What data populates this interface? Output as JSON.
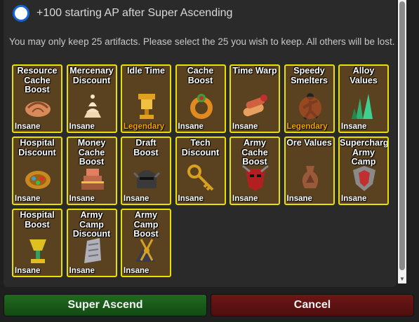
{
  "option": {
    "label": "+100 starting AP after Super Ascending",
    "selected": false
  },
  "info_text": "You may only keep 25 artifacts.  Please select the 25 you wish to keep.  All others will be lost.",
  "colors": {
    "insane": "#ffffff",
    "legendary": "#f0a800",
    "card_border": "#e8e000",
    "card_bg": "#5a4220"
  },
  "artifacts": [
    {
      "title": "Resource Cache Boost",
      "rarity": "Insane",
      "icon": "croissant-icon"
    },
    {
      "title": "Mercenary Discount",
      "rarity": "Insane",
      "icon": "cream-swirl-icon"
    },
    {
      "title": "Idle Time",
      "rarity": "Legendary",
      "icon": "golden-chalice-icon"
    },
    {
      "title": "Cache Boost",
      "rarity": "Insane",
      "icon": "jeweled-ring-icon"
    },
    {
      "title": "Time Warp",
      "rarity": "Insane",
      "icon": "scroll-bundle-icon"
    },
    {
      "title": "Speedy Smelters",
      "rarity": "Legendary",
      "icon": "running-figure-icon"
    },
    {
      "title": "Alloy Values",
      "rarity": "Insane",
      "icon": "green-crystals-icon"
    },
    {
      "title": "Hospital Discount",
      "rarity": "Insane",
      "icon": "gem-plate-icon"
    },
    {
      "title": "Money Cache Boost",
      "rarity": "Insane",
      "icon": "layered-cake-icon"
    },
    {
      "title": "Draft Boost",
      "rarity": "Insane",
      "icon": "knight-helmet-icon"
    },
    {
      "title": "Tech Discount",
      "rarity": "Insane",
      "icon": "golden-key-icon"
    },
    {
      "title": "Army Cache Boost",
      "rarity": "Insane",
      "icon": "red-mask-icon"
    },
    {
      "title": "Ore Values",
      "rarity": "Insane",
      "icon": "amphora-icon"
    },
    {
      "title": "Supercharge Army Camp",
      "rarity": "Insane",
      "icon": "war-crest-icon"
    },
    {
      "title": "Hospital Boost",
      "rarity": "Insane",
      "icon": "gold-goblet-icon"
    },
    {
      "title": "Army Camp Discount",
      "rarity": "Insane",
      "icon": "stone-tablet-icon"
    },
    {
      "title": "Army Camp Boost",
      "rarity": "Insane",
      "icon": "sword-rack-icon"
    }
  ],
  "buttons": {
    "ascend": "Super Ascend",
    "cancel": "Cancel"
  }
}
